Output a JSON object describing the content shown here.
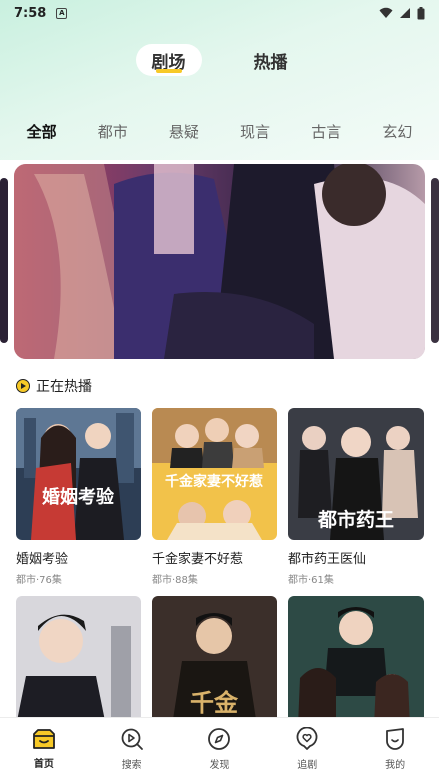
{
  "status": {
    "time": "7:58",
    "notif_letter": "A"
  },
  "main_tabs": [
    {
      "label": "剧场",
      "active": true
    },
    {
      "label": "热播",
      "active": false
    }
  ],
  "categories": [
    "全部",
    "都市",
    "悬疑",
    "现言",
    "古言",
    "玄幻"
  ],
  "section": {
    "title": "正在热播"
  },
  "dramas": [
    {
      "title": "婚姻考验",
      "meta": "都市·76集",
      "poster_text": "婚姻考验"
    },
    {
      "title": "千金家妻不好惹",
      "meta": "都市·88集",
      "poster_text": "千金家妻不好惹"
    },
    {
      "title": "都市药王医仙",
      "meta": "都市·61集",
      "poster_text": "都市药王"
    }
  ],
  "row2_posters": [
    {
      "poster_text": ""
    },
    {
      "poster_text": "千金"
    },
    {
      "poster_text": ""
    }
  ],
  "bottom_nav": [
    {
      "label": "首页",
      "icon": "home-icon",
      "active": true
    },
    {
      "label": "搜索",
      "icon": "search-play-icon",
      "active": false
    },
    {
      "label": "发现",
      "icon": "compass-icon",
      "active": false
    },
    {
      "label": "追剧",
      "icon": "heart-chat-icon",
      "active": false
    },
    {
      "label": "我的",
      "icon": "profile-icon",
      "active": false
    }
  ],
  "colors": {
    "accent": "#f7c927",
    "top_gradient": "#c9f0df"
  }
}
